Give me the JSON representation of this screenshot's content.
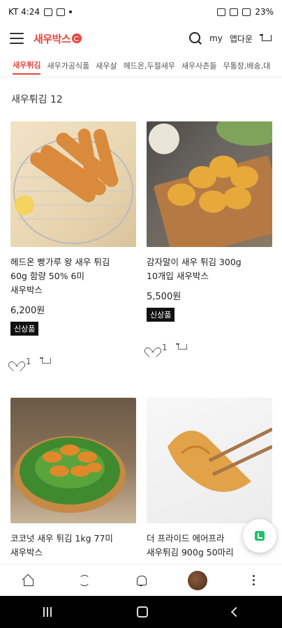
{
  "status_bar": {
    "carrier_time": "KT 4:24",
    "battery": "23%"
  },
  "header": {
    "logo": "새우박스",
    "my_label": "my",
    "app_download_label": "앱다운"
  },
  "tabs": [
    {
      "label": "새우튀김"
    },
    {
      "label": "새우가공식품"
    },
    {
      "label": "새우살"
    },
    {
      "label": "헤드온,두절새우"
    },
    {
      "label": "새우사촌들"
    },
    {
      "label": "무통장,배송,대"
    }
  ],
  "section": {
    "title": "새우튀김 12"
  },
  "products": [
    {
      "name_line1": "헤드온 빵가루 왕 새우 튀김",
      "name_line2": "60g 함량 50% 6미",
      "brand": "새우박스",
      "price": "6,200원",
      "badge": "신상품",
      "likes": "1"
    },
    {
      "name_line1": "감자말이 새우 튀김 300g",
      "name_line2": "10개입 새우박스",
      "brand": "",
      "price": "5,500원",
      "badge": "신상품",
      "likes": "1"
    },
    {
      "name_line1": "코코넛 새우 튀김 1kg 77미",
      "name_line2": "새우박스"
    },
    {
      "name_line1": "더 프라이드 에어프라",
      "name_line2": "새우튀김 900g 50마리"
    }
  ]
}
